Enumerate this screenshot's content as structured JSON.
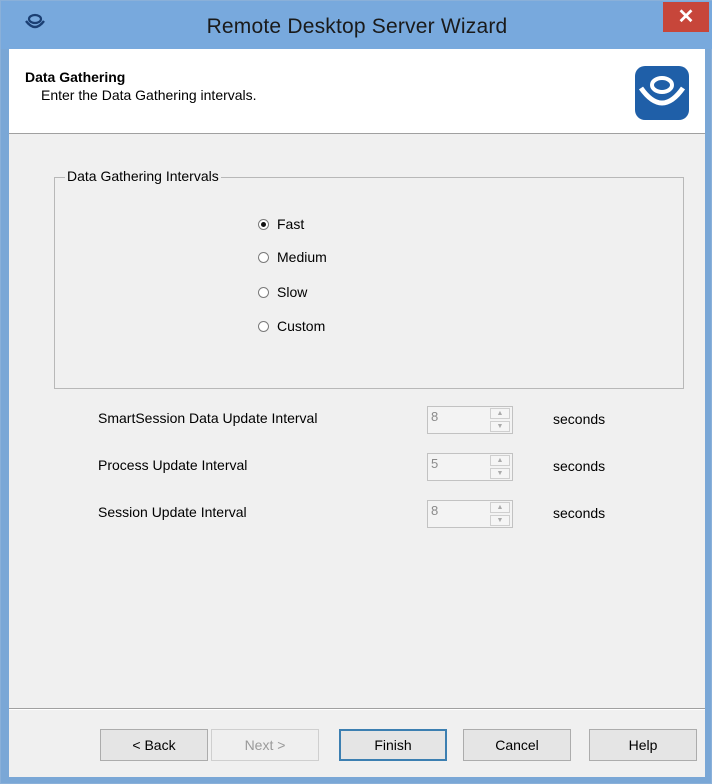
{
  "window": {
    "title": "Remote Desktop Server Wizard",
    "close_glyph": "✕",
    "icon": "thinmanager-icon"
  },
  "header": {
    "title": "Data Gathering",
    "subtitle": "Enter the Data Gathering intervals.",
    "logo": "thinmanager-logo"
  },
  "group": {
    "label": "Data Gathering Intervals",
    "options": [
      {
        "label": "Fast",
        "checked": true
      },
      {
        "label": "Medium",
        "checked": false
      },
      {
        "label": "Slow",
        "checked": false
      },
      {
        "label": "Custom",
        "checked": false
      }
    ]
  },
  "intervals": [
    {
      "label": "SmartSession Data Update Interval",
      "value": "8",
      "unit": "seconds",
      "enabled": false
    },
    {
      "label": "Process Update Interval",
      "value": "5",
      "unit": "seconds",
      "enabled": false
    },
    {
      "label": "Session Update Interval",
      "value": "8",
      "unit": "seconds",
      "enabled": false
    }
  ],
  "buttons": {
    "back": "< Back",
    "next": "Next >",
    "finish": "Finish",
    "cancel": "Cancel",
    "help": "Help"
  },
  "colors": {
    "titlebar": "#78a9dd",
    "close": "#c7463a",
    "default_button_border": "#3c7fb1"
  }
}
